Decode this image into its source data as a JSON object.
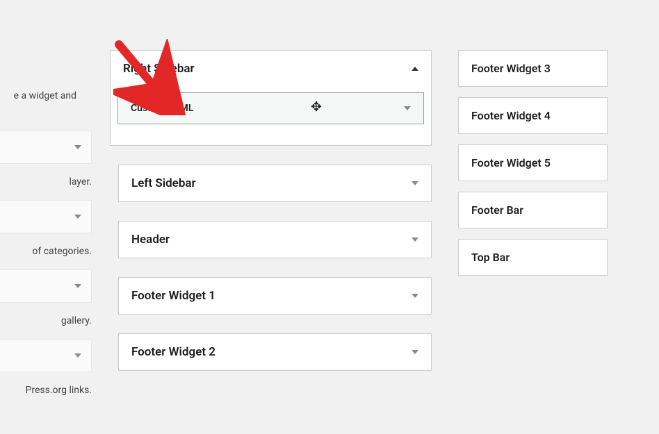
{
  "left": {
    "text1": "e a widget and",
    "text2": "layer.",
    "text3": "of categories.",
    "text4": "gallery.",
    "text5": "Press.org links."
  },
  "center": {
    "areas": [
      {
        "title": "Right Sidebar",
        "open": true,
        "widget": "Custom HTML"
      },
      {
        "title": "Left Sidebar"
      },
      {
        "title": "Header"
      },
      {
        "title": "Footer Widget 1"
      },
      {
        "title": "Footer Widget 2"
      }
    ]
  },
  "right": {
    "areas": [
      "Footer Widget 3",
      "Footer Widget 4",
      "Footer Widget 5",
      "Footer Bar",
      "Top Bar"
    ]
  }
}
